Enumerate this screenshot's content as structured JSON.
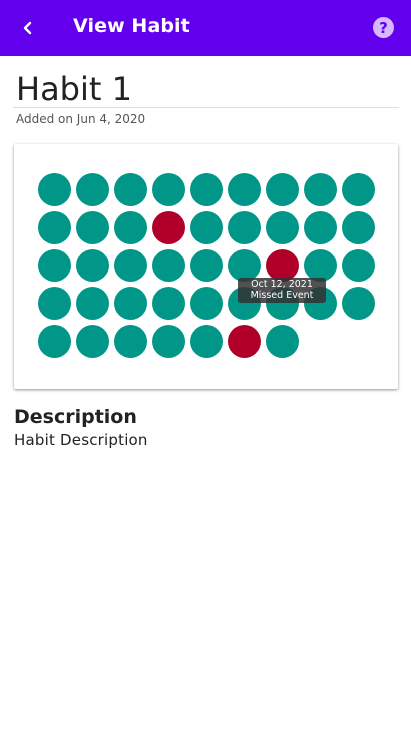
{
  "appbar": {
    "title": "View Habit",
    "back_icon": "chevron-left-icon",
    "help_icon": "help-circle-icon",
    "help_glyph": "?"
  },
  "habit": {
    "name": "Habit 1",
    "added_on": "Added on Jun 4, 2020"
  },
  "events": {
    "rows": [
      [
        "done",
        "done",
        "done",
        "done",
        "done",
        "done",
        "done",
        "done",
        "done"
      ],
      [
        "done",
        "done",
        "done",
        "missed",
        "done",
        "done",
        "done",
        "done",
        "done"
      ],
      [
        "done",
        "done",
        "done",
        "done",
        "done",
        "done",
        "missed",
        "done",
        "done"
      ],
      [
        "done",
        "done",
        "done",
        "done",
        "done",
        "done",
        "done",
        "done",
        "done"
      ],
      [
        "done",
        "done",
        "done",
        "done",
        "done",
        "missed",
        "done"
      ]
    ],
    "tooltip": {
      "date": "Oct 12, 2021",
      "status": "Missed Event"
    }
  },
  "description": {
    "heading": "Description",
    "text": "Habit Description"
  },
  "colors": {
    "appbar": "#6200ee",
    "done": "#009688",
    "missed": "#b0002a"
  }
}
